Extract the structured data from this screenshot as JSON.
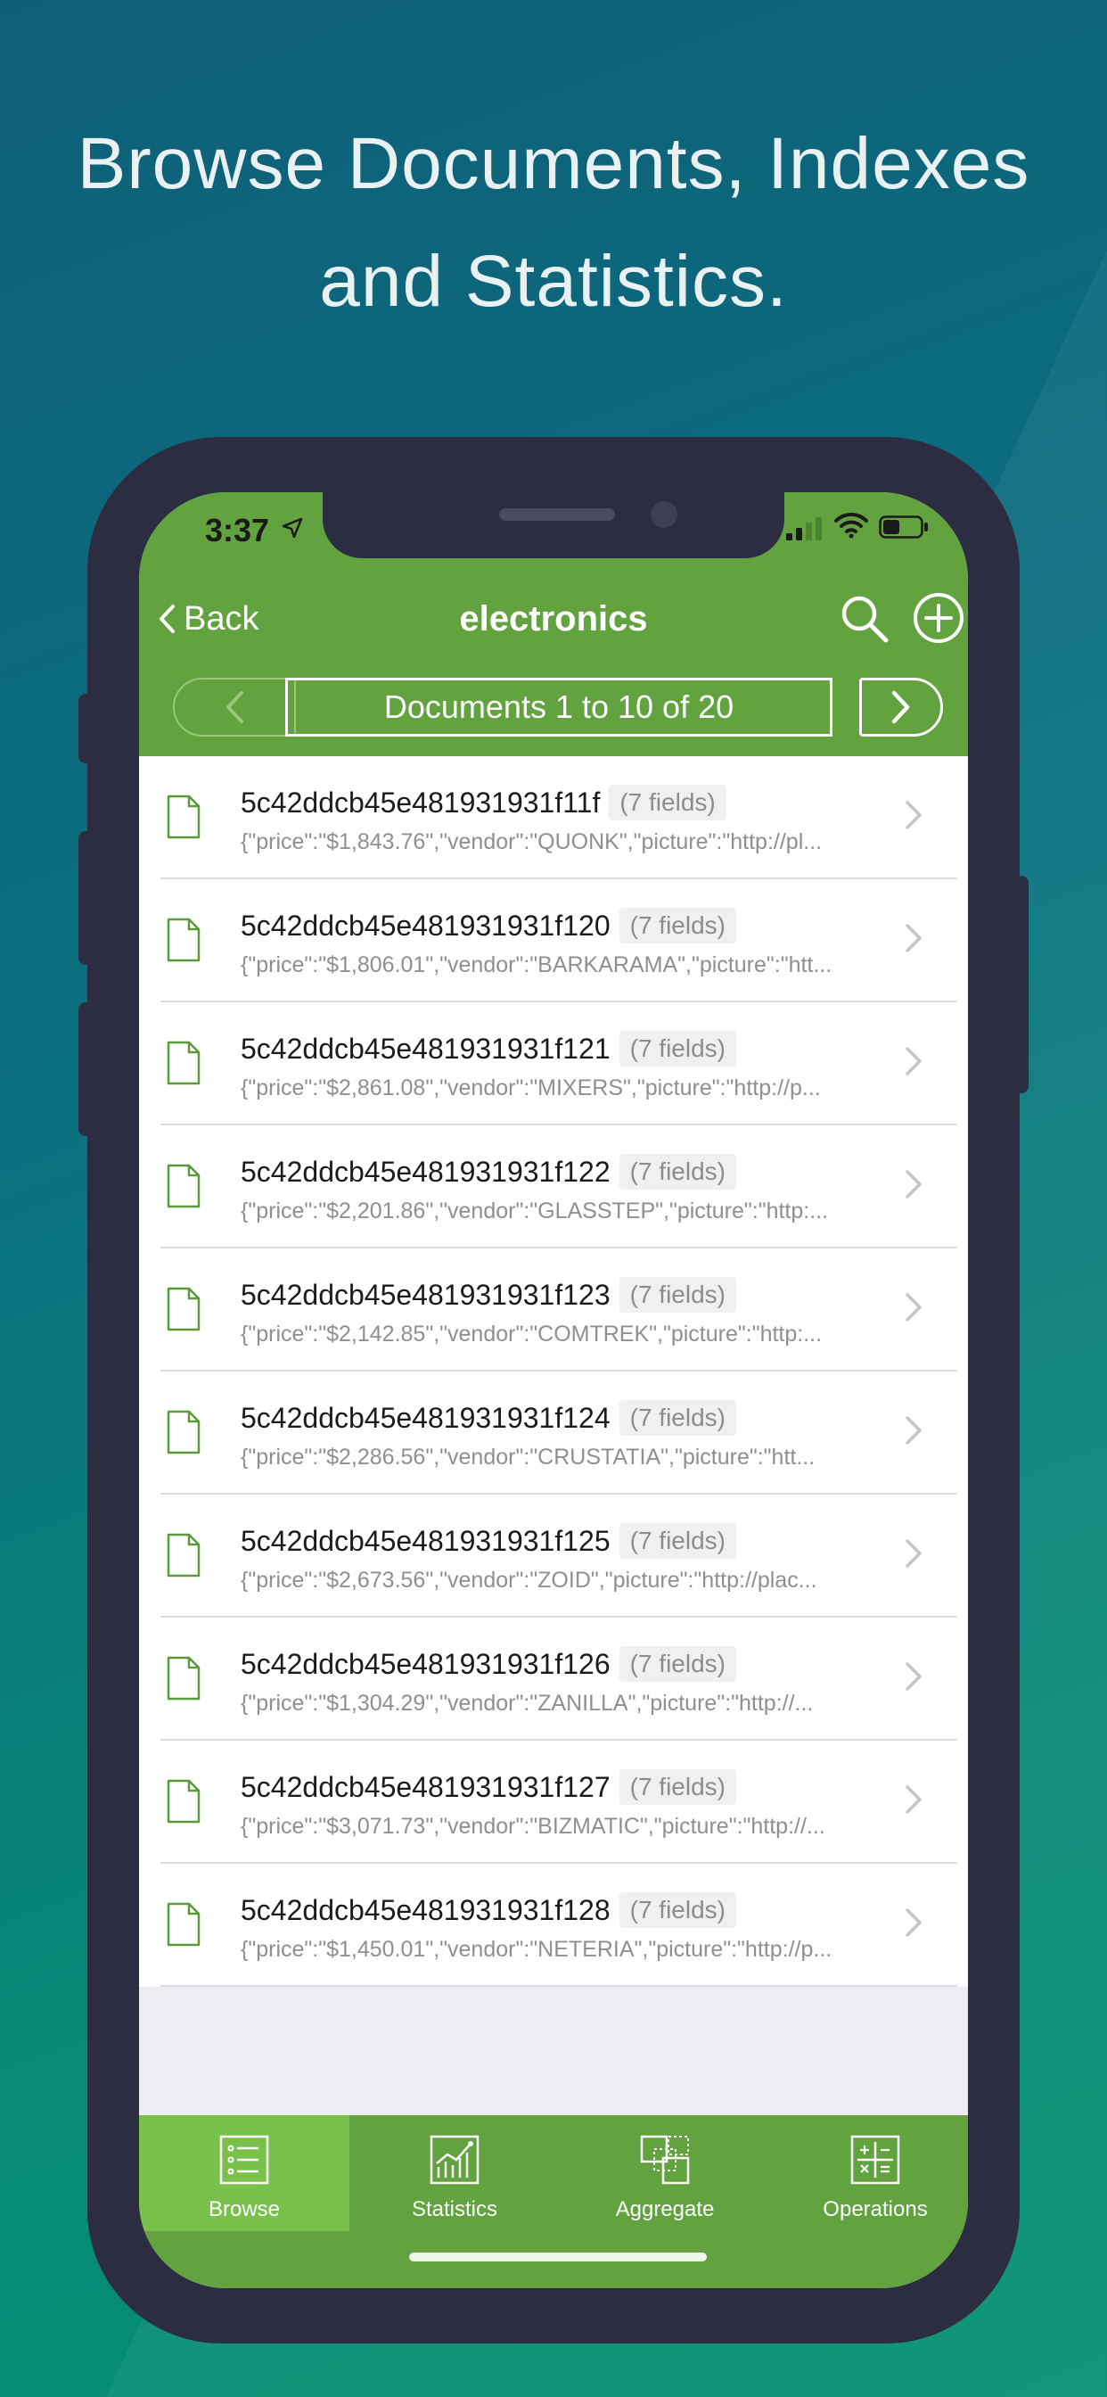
{
  "headline": {
    "line1": "Browse Documents, Indexes",
    "line2": "and Statistics."
  },
  "status_bar": {
    "time": "3:37"
  },
  "nav": {
    "back_label": "Back",
    "title": "electronics"
  },
  "pager": {
    "label": "Documents 1 to 10 of 20"
  },
  "documents": [
    {
      "id": "5c42ddcb45e481931931f11f",
      "fields": "(7 fields)",
      "preview": "{\"price\":\"$1,843.76\",\"vendor\":\"QUONK\",\"picture\":\"http://pl..."
    },
    {
      "id": "5c42ddcb45e481931931f120",
      "fields": "(7 fields)",
      "preview": "{\"price\":\"$1,806.01\",\"vendor\":\"BARKARAMA\",\"picture\":\"htt..."
    },
    {
      "id": "5c42ddcb45e481931931f121",
      "fields": "(7 fields)",
      "preview": "{\"price\":\"$2,861.08\",\"vendor\":\"MIXERS\",\"picture\":\"http://p..."
    },
    {
      "id": "5c42ddcb45e481931931f122",
      "fields": "(7 fields)",
      "preview": "{\"price\":\"$2,201.86\",\"vendor\":\"GLASSTEP\",\"picture\":\"http:..."
    },
    {
      "id": "5c42ddcb45e481931931f123",
      "fields": "(7 fields)",
      "preview": "{\"price\":\"$2,142.85\",\"vendor\":\"COMTREK\",\"picture\":\"http:..."
    },
    {
      "id": "5c42ddcb45e481931931f124",
      "fields": "(7 fields)",
      "preview": "{\"price\":\"$2,286.56\",\"vendor\":\"CRUSTATIA\",\"picture\":\"htt..."
    },
    {
      "id": "5c42ddcb45e481931931f125",
      "fields": "(7 fields)",
      "preview": "{\"price\":\"$2,673.56\",\"vendor\":\"ZOID\",\"picture\":\"http://plac..."
    },
    {
      "id": "5c42ddcb45e481931931f126",
      "fields": "(7 fields)",
      "preview": "{\"price\":\"$1,304.29\",\"vendor\":\"ZANILLA\",\"picture\":\"http://..."
    },
    {
      "id": "5c42ddcb45e481931931f127",
      "fields": "(7 fields)",
      "preview": "{\"price\":\"$3,071.73\",\"vendor\":\"BIZMATIC\",\"picture\":\"http://..."
    },
    {
      "id": "5c42ddcb45e481931931f128",
      "fields": "(7 fields)",
      "preview": "{\"price\":\"$1,450.01\",\"vendor\":\"NETERIA\",\"picture\":\"http://p..."
    }
  ],
  "tabs": [
    {
      "label": "Browse",
      "icon": "list-icon",
      "active": true
    },
    {
      "label": "Statistics",
      "icon": "chart-icon",
      "active": false
    },
    {
      "label": "Aggregate",
      "icon": "aggregate-icon",
      "active": false
    },
    {
      "label": "Operations",
      "icon": "calculator-icon",
      "active": false
    }
  ],
  "colors": {
    "header_green": "#63a33f",
    "active_tab_green": "#79c14a",
    "phone_frame": "#2c2d40",
    "background_teal": "#0b7080"
  }
}
